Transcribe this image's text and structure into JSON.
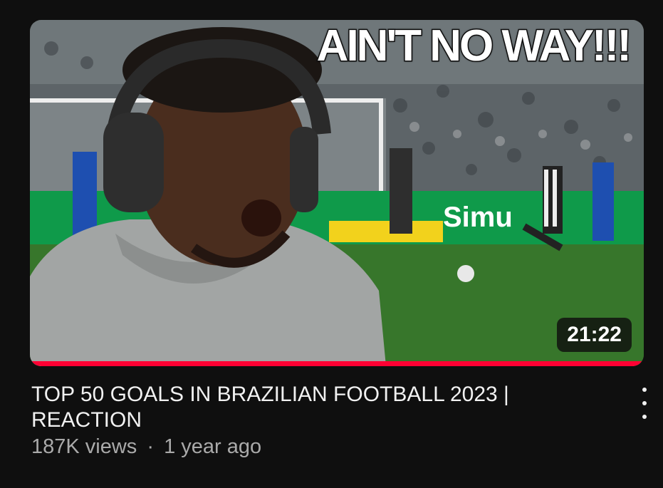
{
  "video": {
    "thumbnail_caption": "AIN'T NO WAY!!!",
    "duration": "21:22",
    "watch_progress": 1.0,
    "title": "TOP 50 GOALS IN BRAZILIAN FOOTBALL 2023 | REACTION",
    "views": "187K views",
    "separator": "·",
    "age": "1 year ago",
    "more_icon": "more-vertical-icon"
  },
  "colors": {
    "background": "#0f0f0f",
    "progress": "#ff0033",
    "title": "#f1f1f1",
    "secondary": "#aaaaaa"
  }
}
